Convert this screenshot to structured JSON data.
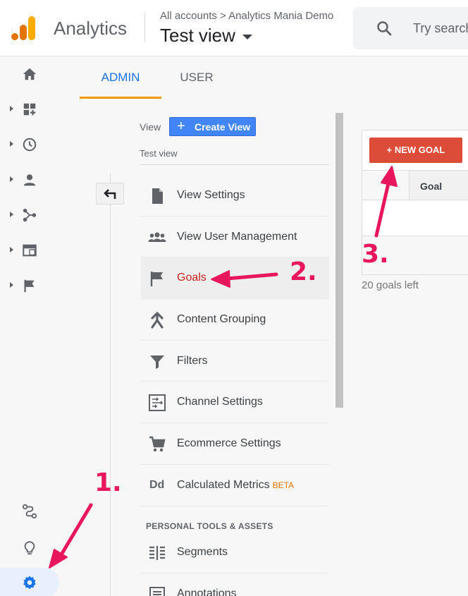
{
  "header": {
    "app_name": "Analytics",
    "breadcrumb": "All accounts > Analytics Mania Demo",
    "view_name": "Test view",
    "search_placeholder": "Try search"
  },
  "tabs": [
    {
      "label": "ADMIN",
      "active": true
    },
    {
      "label": "USER",
      "active": false
    }
  ],
  "view_column": {
    "label": "View",
    "create_button": "Create View",
    "current_view": "Test view"
  },
  "menu": [
    {
      "label": "View Settings",
      "icon": "document-icon"
    },
    {
      "label": "View User Management",
      "icon": "users-icon"
    },
    {
      "label": "Goals",
      "icon": "flag-icon",
      "active": true
    },
    {
      "label": "Content Grouping",
      "icon": "content-grouping-icon"
    },
    {
      "label": "Filters",
      "icon": "filter-icon"
    },
    {
      "label": "Channel Settings",
      "icon": "channel-icon"
    },
    {
      "label": "Ecommerce Settings",
      "icon": "cart-icon"
    },
    {
      "label": "Calculated Metrics",
      "icon": "dd-icon",
      "badge": "BETA"
    }
  ],
  "personal_section": {
    "title": "PERSONAL TOOLS & ASSETS",
    "items": [
      {
        "label": "Segments",
        "icon": "segments-icon"
      },
      {
        "label": "Annotations",
        "icon": "annotations-icon"
      }
    ]
  },
  "goals_panel": {
    "new_goal_button": "+ NEW GOAL",
    "column_header": "Goal",
    "goals_left": "20 goals left"
  },
  "annotations": {
    "step1": "1.",
    "step2": "2.",
    "step3": "3."
  },
  "colors": {
    "accent_blue": "#1a73e8",
    "tab_underline": "#f29900",
    "active_red": "#c5221f",
    "new_goal_red": "#dd4b39",
    "annotation_pink": "#e8175d"
  }
}
